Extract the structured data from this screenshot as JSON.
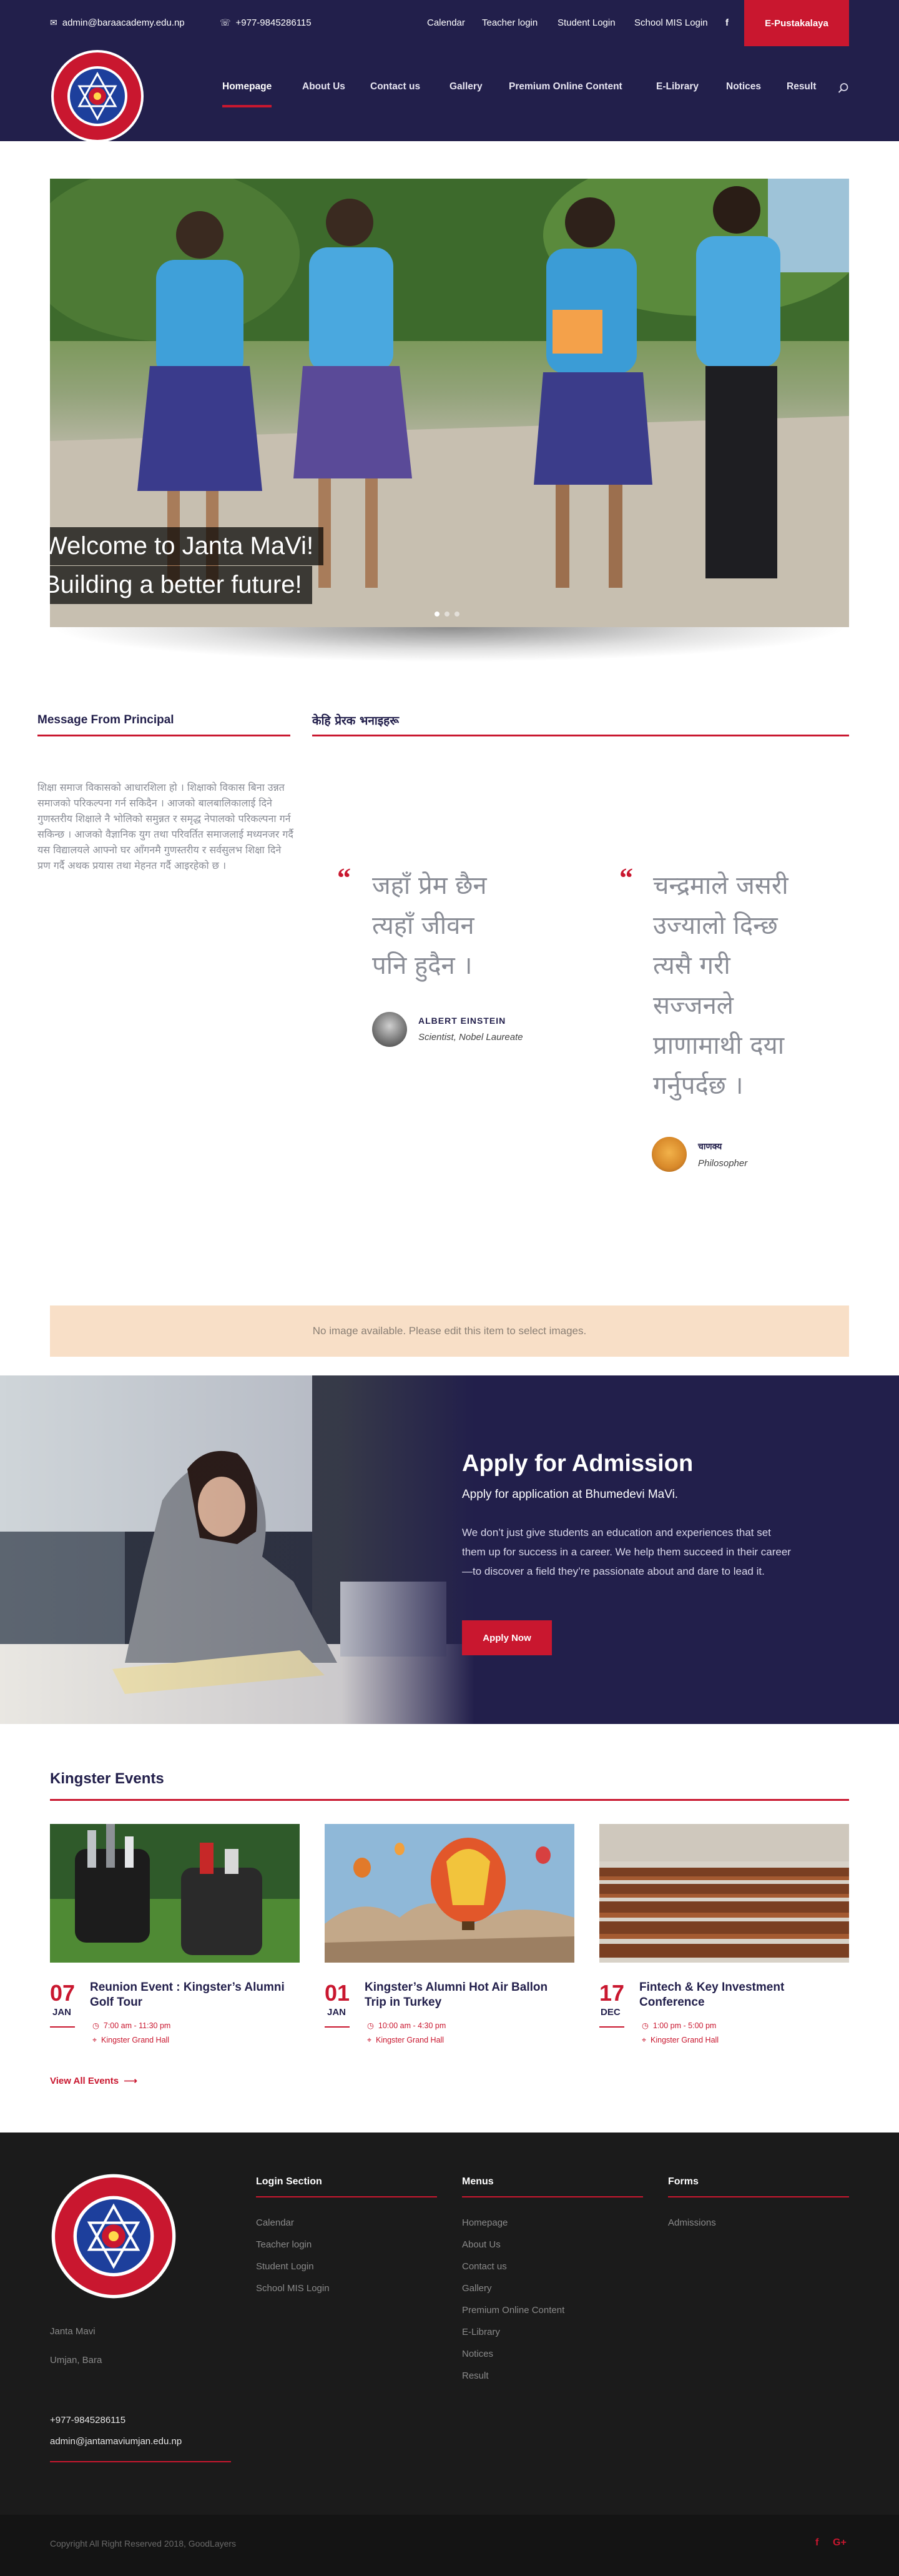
{
  "topbar": {
    "email": "admin@baraacademy.edu.np",
    "phone": "+977-9845286115",
    "links": [
      "Calendar",
      "Teacher login",
      "Student Login",
      "School MIS Login"
    ],
    "facebook_icon": "f",
    "button": "E-Pustakalaya"
  },
  "logo": {
    "lettering": "श्री जनता माध्यमिक विद्यालय · उमजन, बारा",
    "center_text": "JANTA SEC. SCHOOL"
  },
  "nav": {
    "items": [
      "Homepage",
      "About Us",
      "Contact us",
      "Gallery",
      "Premium Online Content",
      "E-Library",
      "Notices",
      "Result"
    ],
    "active": "Homepage"
  },
  "slider": {
    "caption_line1": "Welcome to Janta MaVi!",
    "caption_line2": "Building a better future!"
  },
  "principal": {
    "heading": "Message From Principal",
    "message": "शिक्षा समाज विकासको आधारशिला हो । शिक्षाको विकास बिना उन्नत समाजको परिकल्पना गर्न सकिदैन । आजको बालबालिकालाई दिने गुणस्तरीय शिक्षाले नै भोलिको समुन्नत र समृद्ध नेपालको परिकल्पना गर्न सकिन्छ । आजको वैज्ञानिक युग तथा परिवर्तित समाजलाई मध्यनजर गर्दै यस विद्यालयले आफ्नो घर आँगनमै गुणस्तरीय र सर्वसुलभ शिक्षा दिने प्रण गर्दै अथक प्रयास तथा मेहनत गर्दै आइरहेको छ ।"
  },
  "quotes": {
    "heading": "केहि प्रेरक भनाइहरू",
    "items": [
      {
        "lines": [
          "जहाँ प्रेम छैन",
          "त्यहाँ जीवन",
          "पनि हुदैन ।"
        ],
        "author": "ALBERT EINSTEIN",
        "role": "Scientist, Nobel Laureate"
      },
      {
        "lines": [
          "चन्द्रमाले जसरी",
          "उज्यालो दिन्छ",
          "त्यसै गरी",
          "सज्जनले",
          "प्राणामाथी दया",
          "गर्नुपर्दछ ।"
        ],
        "author": "चाणक्य",
        "role": "Philosopher"
      }
    ]
  },
  "notice_box": "No image available. Please edit this item to select images.",
  "admission": {
    "title": "Apply for Admission",
    "subtitle": "Apply for application at Bhumedevi MaVi.",
    "body": "We don’t just give students an education and experiences that set them up for success in a career. We help them succeed in their career—to discover a field they’re passionate about and dare to lead it.",
    "button": "Apply Now"
  },
  "events": {
    "heading": "Kingster Events",
    "items": [
      {
        "day": "07",
        "month": "JAN",
        "title": "Reunion Event : Kingster’s Alumni Golf Tour",
        "time": "7:00 am - 11:30 pm",
        "location": "Kingster Grand Hall"
      },
      {
        "day": "01",
        "month": "JAN",
        "title": "Kingster’s Alumni Hot Air Ballon Trip in Turkey",
        "time": "10:00 am - 4:30 pm",
        "location": "Kingster Grand Hall"
      },
      {
        "day": "17",
        "month": "DEC",
        "title": "Fintech & Key Investment Conference",
        "time": "1:00 pm - 5:00 pm",
        "location": "Kingster Grand Hall"
      }
    ],
    "view_all": "View All Events"
  },
  "footer": {
    "school_name": "Janta Mavi",
    "address": "Umjan, Bara",
    "phone": "+977-9845286115",
    "email": "admin@jantamaviumjan.edu.np",
    "login": {
      "heading": "Login Section",
      "links": [
        "Calendar",
        "Teacher login",
        "Student Login",
        "School MIS Login"
      ]
    },
    "menus": {
      "heading": "Menus",
      "links": [
        "Homepage",
        "About Us",
        "Contact us",
        "Gallery",
        "Premium Online Content",
        "E-Library",
        "Notices",
        "Result"
      ]
    },
    "forms": {
      "heading": "Forms",
      "links": [
        "Admissions"
      ]
    },
    "copyright": "Copyright All Right Reserved 2018, GoodLayers",
    "social": [
      "f",
      "G+"
    ]
  },
  "colors": {
    "navy": "#221f4b",
    "red": "#c9172f",
    "footer": "#1b1b1b"
  }
}
